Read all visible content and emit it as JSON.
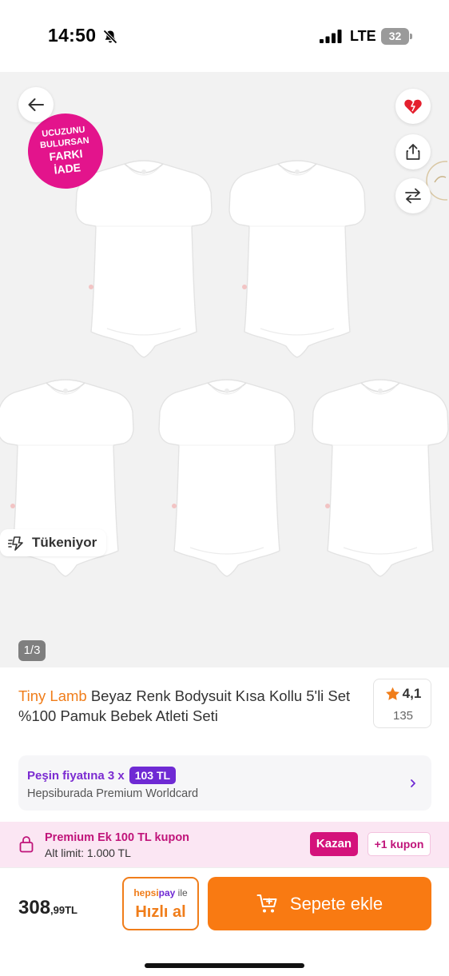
{
  "status_bar": {
    "time": "14:50",
    "network": "LTE",
    "battery": "32"
  },
  "gallery": {
    "promo_badge": [
      "UCUZUNU",
      "BULURSAN",
      "FARKI",
      "İADE"
    ],
    "stock_chip": "Tükeniyor",
    "counter": "1/3",
    "icons": [
      "back-arrow-icon",
      "heart-icon",
      "share-icon",
      "compare-icon"
    ]
  },
  "product": {
    "brand": "Tiny Lamb",
    "title": "Beyaz Renk Bodysuit Kısa Kollu 5'li Set %100 Pamuk  Bebek Atleti Seti",
    "rating": "4,1",
    "review_count": "135"
  },
  "installment": {
    "label": "Peşin fiyatına 3 x",
    "amount": "103 TL",
    "card": "Hepsiburada Premium Worldcard"
  },
  "coupon": {
    "title": "Premium Ek 100 TL kupon",
    "subtitle": "Alt limit: 1.000 TL",
    "earn_label": "Kazan",
    "more_label": "+1 kupon"
  },
  "bottom_bar": {
    "price_main": "308",
    "price_cents": ",99TL",
    "quick_brand_hepsi": "hepsi",
    "quick_brand_pay": "pay",
    "quick_brand_suffix": " ile",
    "quick_buy_label": "Hızlı al",
    "add_to_cart_label": "Sepete ekle"
  },
  "colors": {
    "brand_orange": "#f97a12",
    "premium_purple": "#6f2ad4",
    "promo_pink": "#e3148c"
  }
}
